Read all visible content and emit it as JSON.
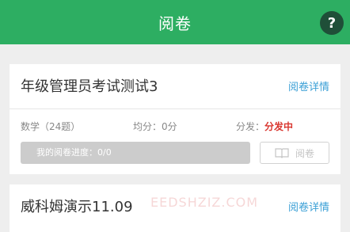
{
  "header": {
    "title": "阅卷",
    "help_icon": "help-icon",
    "help_label": "?",
    "bg_color": "#2dae62"
  },
  "exams": [
    {
      "title": "年级管理员考试测试3",
      "detail_label": "阅卷详情",
      "subject": "数学（24题）",
      "average": "均分：0分",
      "distribution_label": "分发：",
      "distribution_status": "分发中",
      "progress_text": "我的阅卷进度：0/0",
      "grade_button_label": "阅卷"
    },
    {
      "title": "威科姆演示11.09",
      "detail_label": "阅卷详情"
    }
  ],
  "watermark": "EEDSHZIZ.COM",
  "colors": {
    "accent": "#2dae62",
    "link": "#3a9fd6",
    "status_red": "#d9362f"
  }
}
